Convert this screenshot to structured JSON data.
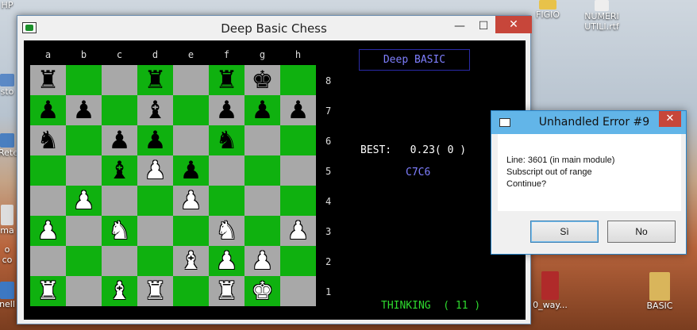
{
  "desktop": {
    "icons": [
      {
        "label": "HP",
        "id": "hp"
      },
      {
        "label": "sto",
        "id": "sto"
      },
      {
        "label": "Rete",
        "id": "rete"
      },
      {
        "label": "ma",
        "id": "ma"
      },
      {
        "label": "o co",
        "id": "oco"
      },
      {
        "label": "nell",
        "id": "nell"
      },
      {
        "label": "FIGIO",
        "id": "figio"
      },
      {
        "label": "NUMERI",
        "id": "numeri1"
      },
      {
        "label": "UTILI.rtf",
        "id": "numeri2"
      },
      {
        "label": "BASIC",
        "id": "basic"
      },
      {
        "label": "0_way...",
        "id": "way"
      }
    ]
  },
  "window": {
    "title": "Deep Basic Chess",
    "minimize": "—",
    "maximize": "☐",
    "close": "✕"
  },
  "board": {
    "files": [
      "a",
      "b",
      "c",
      "d",
      "e",
      "f",
      "g",
      "h"
    ],
    "ranks": [
      "8",
      "7",
      "6",
      "5",
      "4",
      "3",
      "2",
      "1"
    ],
    "squares": [
      [
        "bR",
        "",
        "",
        "bR",
        "",
        "bR",
        "bK",
        ""
      ],
      [
        "bP",
        "bP",
        "",
        "bB",
        "",
        "bP",
        "bP",
        "bP"
      ],
      [
        "bN",
        "",
        "bP",
        "bP",
        "",
        "bN",
        "",
        ""
      ],
      [
        "",
        "",
        "bB",
        "wP",
        "bP",
        "",
        "",
        ""
      ],
      [
        "",
        "wP",
        "",
        "",
        "wP",
        "",
        "",
        ""
      ],
      [
        "wP",
        "",
        "wN",
        "",
        "",
        "wN",
        "",
        "wP"
      ],
      [
        "",
        "",
        "",
        "",
        "wB",
        "wP",
        "wP",
        ""
      ],
      [
        "wR",
        "",
        "wB",
        "wR",
        "",
        "wR",
        "wK",
        ""
      ]
    ]
  },
  "panel": {
    "engine_name": "Deep BASIC",
    "best_label": "BEST:",
    "best_value": "0.23( 0 )",
    "best_move": "C7C6",
    "thinking_label": "THINKING",
    "thinking_value": "( 11 )"
  },
  "dialog": {
    "title": "Unhandled Error #9",
    "close": "✕",
    "lines": [
      "Line: 3601 (in main module)",
      "Subscript out of range",
      "Continue?"
    ],
    "yes_label": "Sì",
    "no_label": "No"
  },
  "colors": {
    "light_square": "#0fb10f",
    "dark_square": "#a8a8a8",
    "engine_text": "#7f7fff",
    "thinking_text": "#2edb2e",
    "dialog_title": "#62b5e8"
  }
}
